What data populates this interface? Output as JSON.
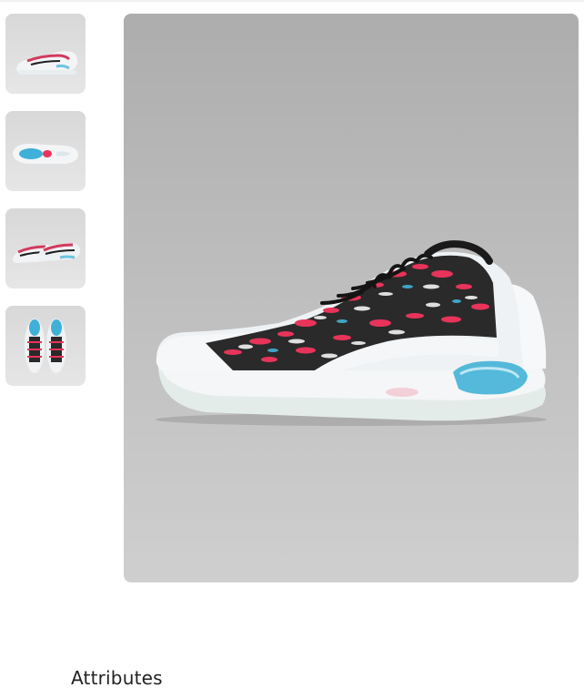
{
  "gallery": {
    "thumbnails": [
      {
        "view": "side-view",
        "selected": true
      },
      {
        "view": "sole-view",
        "selected": false
      },
      {
        "view": "pair-view",
        "selected": false
      },
      {
        "view": "top-view",
        "selected": false
      }
    ],
    "main_image": {
      "view": "side-view"
    }
  },
  "section": {
    "heading": "Attributes"
  },
  "colors": {
    "background": "#ffffff",
    "photo_backdrop": "#b5b5b5",
    "shoe_upper": "#eef2f4",
    "pattern_pink": "#e8345a",
    "pattern_black": "#1a1a1a",
    "sole_blue": "#43b3d6",
    "text": "#222222"
  }
}
